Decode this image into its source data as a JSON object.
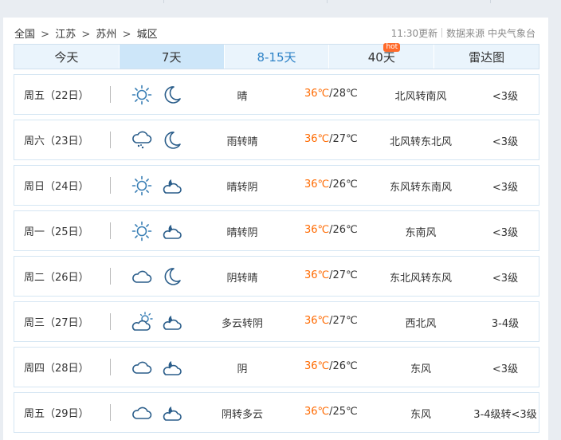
{
  "breadcrumb": [
    "全国",
    "江苏",
    "苏州",
    "城区"
  ],
  "breadcrumb_sep": ">",
  "update_time": "11:30更新",
  "source": "数据来源 中央气象台",
  "tabs": [
    {
      "label": "今天"
    },
    {
      "label": "7天",
      "active": true
    },
    {
      "label": "8-15天"
    },
    {
      "label": "40天",
      "badge": "hot"
    },
    {
      "label": "雷达图"
    }
  ],
  "colors": {
    "high_temp": "#ff6a00",
    "icon": "#2a5d8a",
    "sun": "#3a7fb5"
  },
  "forecast": [
    {
      "day": "周五（22日）",
      "icon_day": "sun-icon",
      "icon_night": "moon-icon",
      "weather": "晴",
      "high": "36℃",
      "low": "/28℃",
      "wind": "北风转南风",
      "level": "<3级"
    },
    {
      "day": "周六（23日）",
      "icon_day": "rain-cloud-icon",
      "icon_night": "moon-icon",
      "weather": "雨转晴",
      "high": "36℃",
      "low": "/27℃",
      "wind": "北风转东北风",
      "level": "<3级"
    },
    {
      "day": "周日（24日）",
      "icon_day": "sun-icon",
      "icon_night": "moon-cloud-icon",
      "weather": "晴转阴",
      "high": "36℃",
      "low": "/26℃",
      "wind": "东风转东南风",
      "level": "<3级"
    },
    {
      "day": "周一（25日）",
      "icon_day": "sun-icon",
      "icon_night": "moon-cloud-icon",
      "weather": "晴转阴",
      "high": "36℃",
      "low": "/26℃",
      "wind": "东南风",
      "level": "<3级"
    },
    {
      "day": "周二（26日）",
      "icon_day": "cloud-icon",
      "icon_night": "moon-icon",
      "weather": "阴转晴",
      "high": "36℃",
      "low": "/27℃",
      "wind": "东北风转东风",
      "level": "<3级"
    },
    {
      "day": "周三（27日）",
      "icon_day": "sun-cloud-icon",
      "icon_night": "moon-cloud-icon",
      "weather": "多云转阴",
      "high": "36℃",
      "low": "/27℃",
      "wind": "西北风",
      "level": "3-4级"
    },
    {
      "day": "周四（28日）",
      "icon_day": "cloud-icon",
      "icon_night": "moon-cloud-icon",
      "weather": "阴",
      "high": "36℃",
      "low": "/26℃",
      "wind": "东风",
      "level": "<3级"
    },
    {
      "day": "周五（29日）",
      "icon_day": "cloud-icon",
      "icon_night": "moon-cloud-icon",
      "weather": "阴转多云",
      "high": "36℃",
      "low": "/25℃",
      "wind": "东风",
      "level": "3-4级转<3级"
    }
  ]
}
